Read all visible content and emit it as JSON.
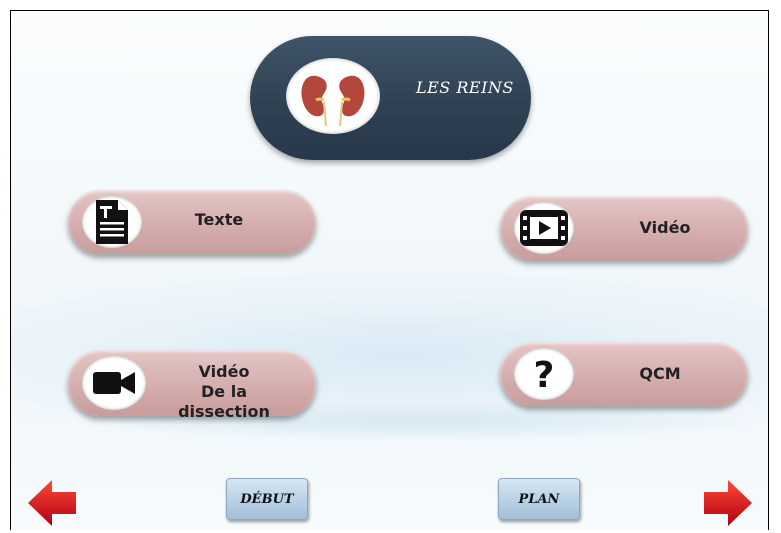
{
  "title": {
    "label": "LES REINS"
  },
  "menu": {
    "texte": {
      "label": "Texte"
    },
    "video": {
      "label": "Vidéo"
    },
    "video_dissection": {
      "line1": "Vidéo",
      "line2": "De la dissection"
    },
    "qcm": {
      "label": "QCM"
    }
  },
  "nav": {
    "debut": {
      "label": "DÉBUT"
    },
    "plan": {
      "label": "PLAN"
    }
  },
  "icons": {
    "title": "kidneys-icon",
    "texte": "document-icon",
    "video": "film-icon",
    "video_dissection": "video-camera-icon",
    "qcm": "question-mark-icon",
    "prev": "arrow-left-icon",
    "next": "arrow-right-icon"
  },
  "colors": {
    "title_pill": "#2f4253",
    "menu_pill": "#d6b0b0",
    "nav_button": "#b6cfe4",
    "arrows": "#d0141e"
  }
}
